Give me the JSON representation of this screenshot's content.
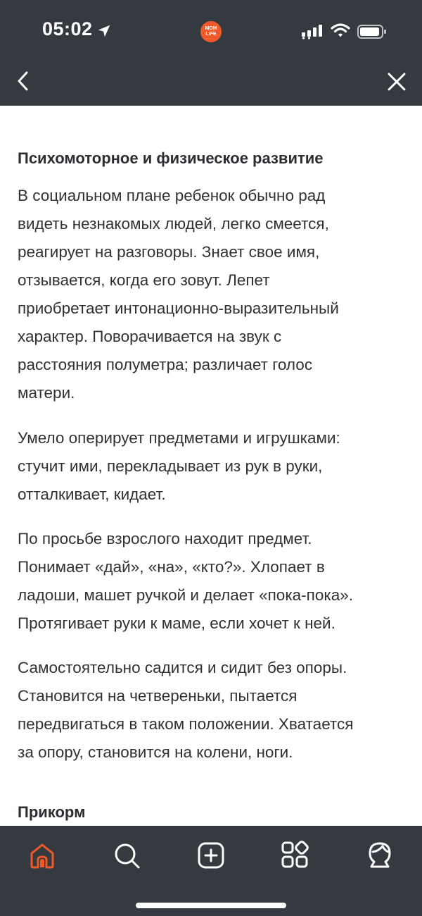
{
  "status_bar": {
    "time": "05:02",
    "app_badge_line1": "MOM",
    "app_badge_line2": "LIFE"
  },
  "nav": {
    "back_icon": "chevron-left-icon",
    "close_icon": "close-icon"
  },
  "article": {
    "heading": "Психомоторное и физическое развитие",
    "paragraphs": [
      {
        "lines": [
          "В социальном плане ребенок обычно рад",
          "видеть незнакомых людей, легко смеется,",
          "реагирует на разговоры. Знает свое имя,",
          "отзывается, когда его зовут. Лепет",
          "приобретает интонационно-выразительный",
          "характер. Поворачивается на звук с",
          "расстояния полуметра; различает голос",
          "матери."
        ]
      },
      {
        "lines": [
          "Умело оперирует предметами и игрушками:",
          "стучит ими, перекладывает из рук в руки,",
          "отталкивает, кидает."
        ]
      },
      {
        "lines": [
          "По просьбе взрослого находит предмет.",
          "Понимает «дай», «на», «кто?». Хлопает в",
          "ладоши, машет ручкой и делает «пока-пока».",
          "Протягивает руки к маме, если хочет к ней."
        ]
      },
      {
        "lines": [
          "Самостоятельно садится и сидит без опоры.",
          "Становится на четвереньки, пытается",
          "передвигаться в таком положении. Хватается",
          "за опору, становится на колени, ноги."
        ]
      }
    ],
    "next_heading": "Прикорм"
  },
  "tab_bar": {
    "tabs": [
      {
        "name": "home",
        "icon": "home-icon",
        "active": true
      },
      {
        "name": "search",
        "icon": "search-icon",
        "active": false
      },
      {
        "name": "create",
        "icon": "add-square-icon",
        "active": false
      },
      {
        "name": "services",
        "icon": "apps-grid-icon",
        "active": false
      },
      {
        "name": "profile",
        "icon": "profile-icon",
        "active": false
      }
    ]
  },
  "colors": {
    "bar_background": "#343a3f",
    "accent": "#f05a2b",
    "text": "#2e3135"
  }
}
